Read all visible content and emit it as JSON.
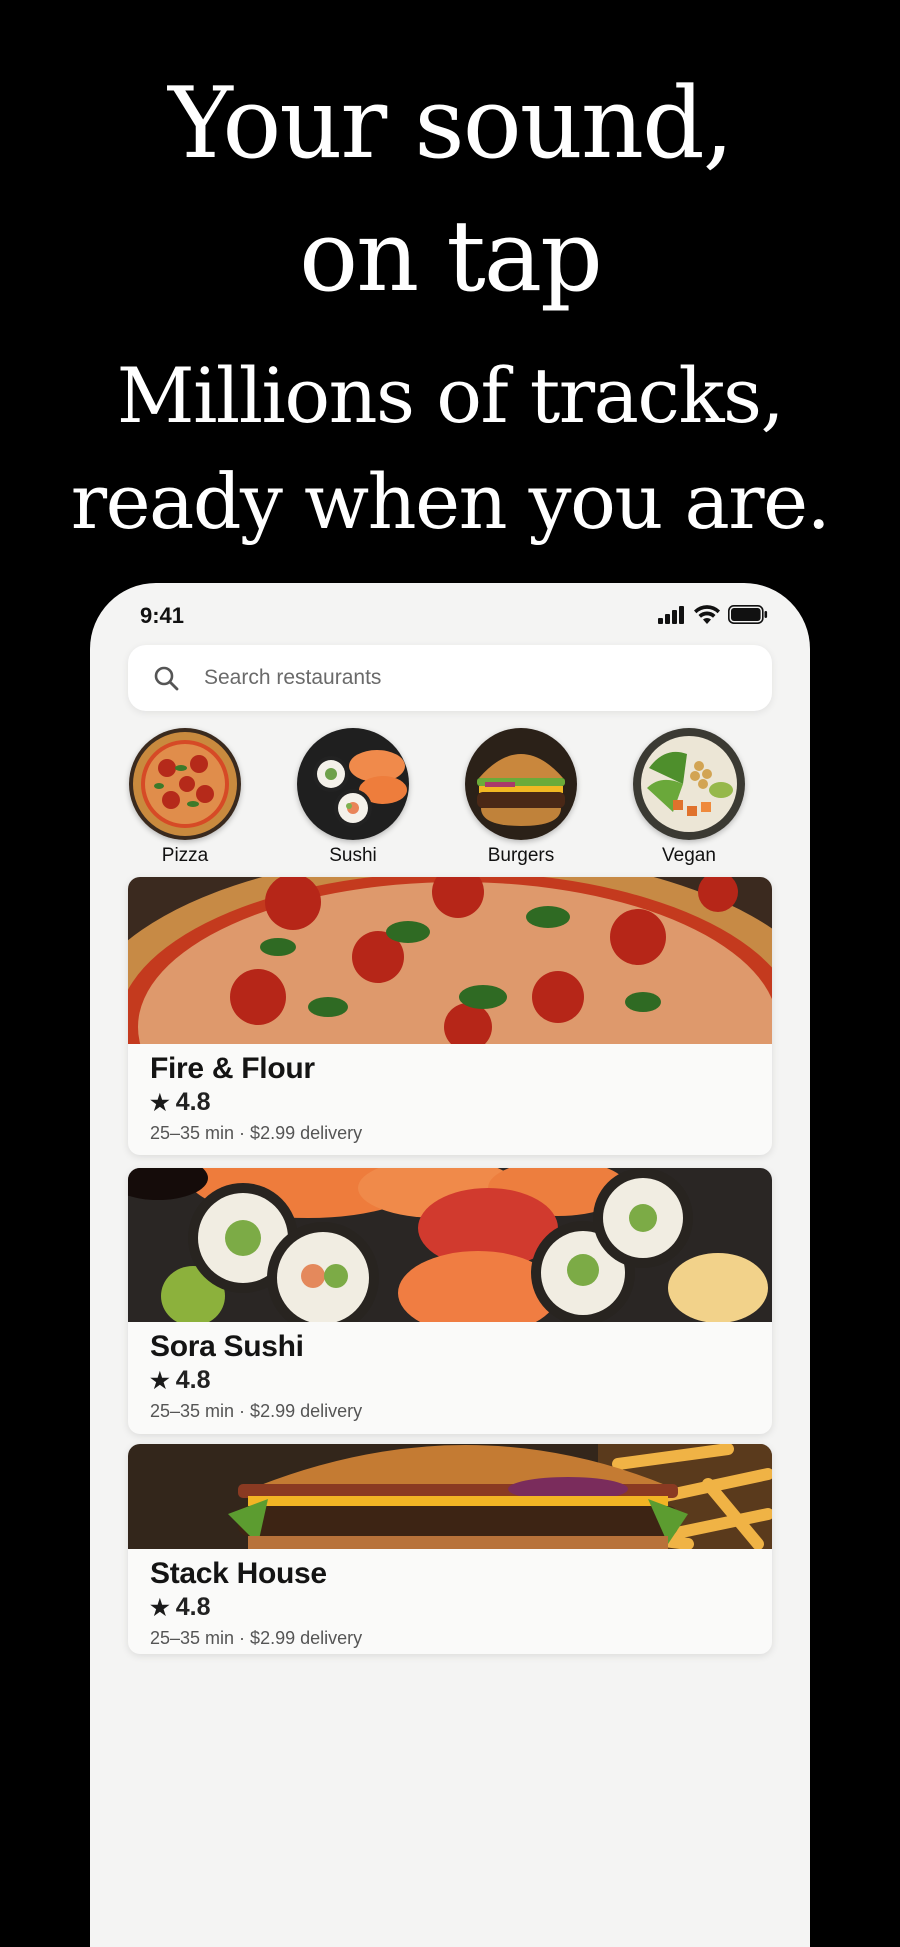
{
  "hero": {
    "title_line1": "Your sound,",
    "title_line2": "on tap",
    "subtitle_line1": "Millions of tracks,",
    "subtitle_line2": "ready when you are."
  },
  "status_bar": {
    "time": "9:41",
    "icons": [
      "cellular-signal-icon",
      "wifi-icon",
      "battery-icon"
    ]
  },
  "search": {
    "placeholder": "Search restaurants",
    "value": "",
    "icon": "search-icon"
  },
  "categories": [
    {
      "label": "Pizza",
      "icon": "pizza-image"
    },
    {
      "label": "Sushi",
      "icon": "sushi-image"
    },
    {
      "label": "Burgers",
      "icon": "burger-image"
    },
    {
      "label": "Vegan",
      "icon": "vegan-bowl-image"
    }
  ],
  "restaurants": [
    {
      "name": "Fire & Flour",
      "rating": "4.8",
      "meta": "25–35 min · $2.99 delivery",
      "image": "pizza-photo"
    },
    {
      "name": "Sora Sushi",
      "rating": "4.8",
      "meta": "25–35 min · $2.99 delivery",
      "image": "sushi-photo"
    },
    {
      "name": "Stack House",
      "rating": "4.8",
      "meta": "25–35 min · $2.99 delivery",
      "image": "burger-photo"
    }
  ],
  "colors": {
    "background": "#000000",
    "phone_surface": "#f4f4f3",
    "card_surface": "#fafaf9",
    "headline_text": "#ffffff"
  }
}
